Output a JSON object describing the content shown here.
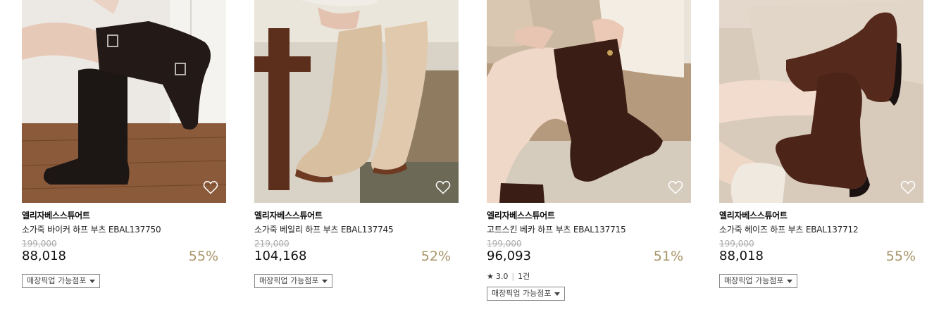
{
  "products": [
    {
      "brand": "엘리자베스스튜어트",
      "name": "소가죽 바이커 하프 부츠 EBAL137750",
      "original_price": "199,000",
      "price": "88,018",
      "discount": "55%",
      "pickup_label": "매장픽업 가능점포",
      "image_icon": "black-biker-boots-photo"
    },
    {
      "brand": "엘리자베스스튜어트",
      "name": "소가죽 베일리 하프 부츠 EBAL137745",
      "original_price": "219,000",
      "price": "104,168",
      "discount": "52%",
      "pickup_label": "매장픽업 가능점포",
      "image_icon": "beige-suede-boots-photo"
    },
    {
      "brand": "엘리자베스스튜어트",
      "name": "고트스킨 베카 하프 부츠 EBAL137715",
      "original_price": "199,000",
      "price": "96,093",
      "discount": "51%",
      "rating": "3.0",
      "review_count": "1건",
      "pickup_label": "매장픽업 가능점포",
      "image_icon": "brown-goatskin-boots-photo"
    },
    {
      "brand": "엘리자베스스튜어트",
      "name": "소가죽 헤이즈 하프 부츠 EBAL137712",
      "original_price": "199,000",
      "price": "88,018",
      "discount": "55%",
      "pickup_label": "매장픽업 가능점포",
      "image_icon": "brown-chunky-boots-photo"
    }
  ],
  "colors": {
    "discount": "#a89468",
    "original_price": "#aaaaaa"
  }
}
